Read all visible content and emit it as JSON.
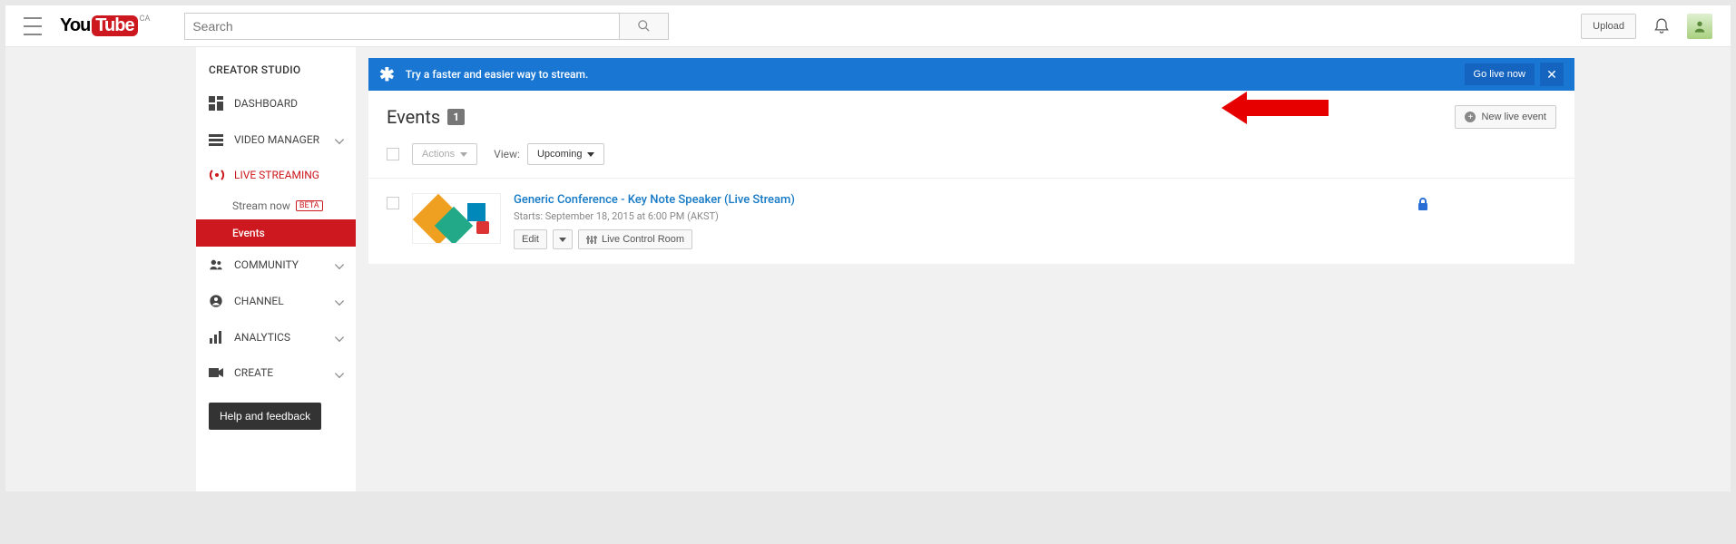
{
  "header": {
    "region_code": "CA",
    "search_placeholder": "Search",
    "upload_label": "Upload"
  },
  "sidebar": {
    "title": "CREATOR STUDIO",
    "items": [
      {
        "label": "DASHBOARD"
      },
      {
        "label": "VIDEO MANAGER"
      },
      {
        "label": "LIVE STREAMING"
      },
      {
        "label": "COMMUNITY"
      },
      {
        "label": "CHANNEL"
      },
      {
        "label": "ANALYTICS"
      },
      {
        "label": "CREATE"
      }
    ],
    "live_sub": {
      "stream_now": "Stream now",
      "beta": "BETA",
      "events": "Events"
    },
    "help": "Help and feedback"
  },
  "banner": {
    "text": "Try a faster and easier way to stream.",
    "go_live": "Go live now"
  },
  "events": {
    "title": "Events",
    "count": "1",
    "new_event": "New live event",
    "actions": "Actions",
    "view_label": "View:",
    "view_value": "Upcoming",
    "row": {
      "title": "Generic Conference - Key Note Speaker (Live Stream)",
      "starts": "Starts: September 18, 2015 at 6:00 PM (AKST)",
      "edit": "Edit",
      "lcr": "Live Control Room"
    }
  }
}
